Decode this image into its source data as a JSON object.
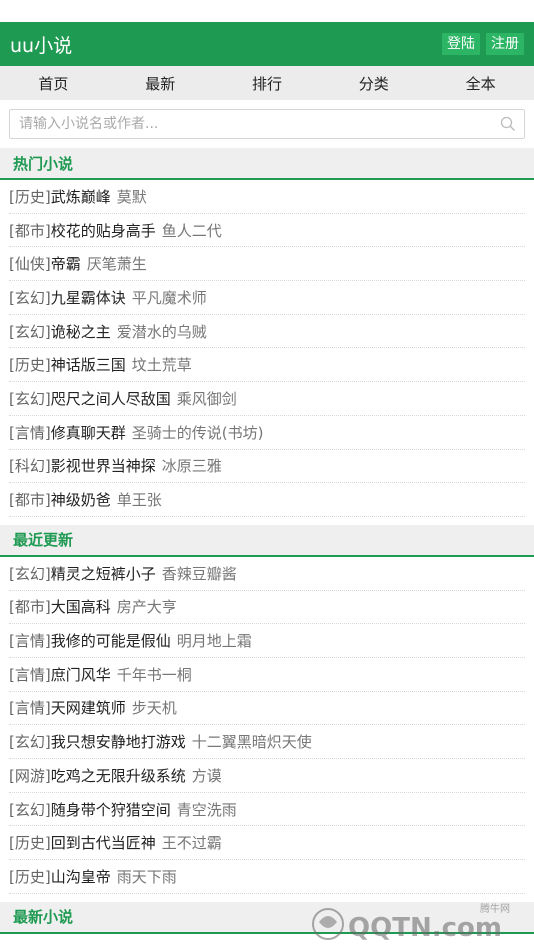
{
  "header": {
    "brand": "uu小说",
    "login_label": "登陆",
    "register_label": "注册"
  },
  "nav": [
    {
      "label": "首页"
    },
    {
      "label": "最新"
    },
    {
      "label": "排行"
    },
    {
      "label": "分类"
    },
    {
      "label": "全本"
    }
  ],
  "search": {
    "placeholder": "请输入小说名或作者..."
  },
  "hot": {
    "title": "热门小说",
    "items": [
      {
        "cat": "[历史]",
        "title": "武炼巅峰",
        "author": "莫默"
      },
      {
        "cat": "[都市]",
        "title": "校花的贴身高手",
        "author": "鱼人二代"
      },
      {
        "cat": "[仙侠]",
        "title": "帝霸",
        "author": "厌笔萧生"
      },
      {
        "cat": "[玄幻]",
        "title": "九星霸体诀",
        "author": "平凡魔术师"
      },
      {
        "cat": "[玄幻]",
        "title": "诡秘之主",
        "author": "爱潜水的乌贼"
      },
      {
        "cat": "[历史]",
        "title": "神话版三国",
        "author": "坟土荒草"
      },
      {
        "cat": "[玄幻]",
        "title": "咫尺之间人尽敌国",
        "author": "乘风御剑"
      },
      {
        "cat": "[言情]",
        "title": "修真聊天群",
        "author": "圣骑士的传说(书坊)"
      },
      {
        "cat": "[科幻]",
        "title": "影视世界当神探",
        "author": "冰原三雅"
      },
      {
        "cat": "[都市]",
        "title": "神级奶爸",
        "author": "单王张"
      }
    ]
  },
  "recent": {
    "title": "最近更新",
    "items": [
      {
        "cat": "[玄幻]",
        "title": "精灵之短裤小子",
        "author": "香辣豆瓣酱"
      },
      {
        "cat": "[都市]",
        "title": "大国高科",
        "author": "房产大亨"
      },
      {
        "cat": "[言情]",
        "title": "我修的可能是假仙",
        "author": "明月地上霜"
      },
      {
        "cat": "[言情]",
        "title": "庶门风华",
        "author": "千年书一桐"
      },
      {
        "cat": "[言情]",
        "title": "天网建筑师",
        "author": "步天机"
      },
      {
        "cat": "[玄幻]",
        "title": "我只想安静地打游戏",
        "author": "十二翼黑暗炽天使"
      },
      {
        "cat": "[网游]",
        "title": "吃鸡之无限升级系统",
        "author": "方谟"
      },
      {
        "cat": "[玄幻]",
        "title": "随身带个狩猎空间",
        "author": "青空洗雨"
      },
      {
        "cat": "[历史]",
        "title": "回到古代当匠神",
        "author": "王不过霸"
      },
      {
        "cat": "[历史]",
        "title": "山沟皇帝",
        "author": "雨天下雨"
      }
    ]
  },
  "newest": {
    "title": "最新小说"
  },
  "watermark": {
    "text": "QQTN.com",
    "sub": "腾牛网"
  },
  "colors": {
    "brand_green": "#1f9a52",
    "button_green": "#2bb564"
  }
}
